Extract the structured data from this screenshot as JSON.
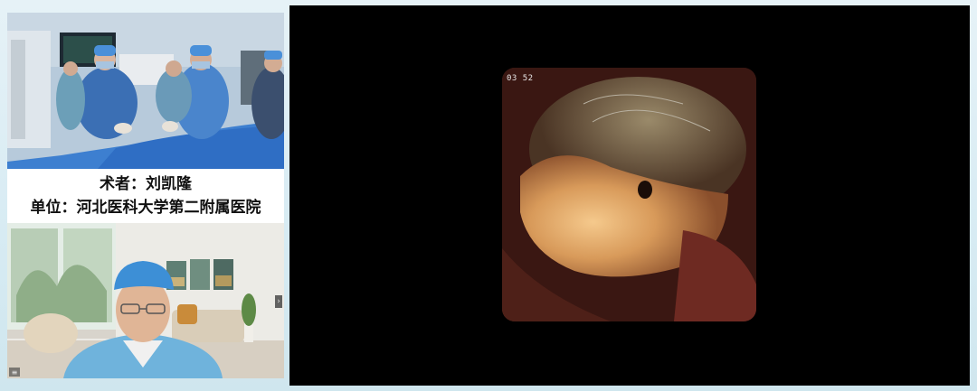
{
  "surgeon_caption": {
    "surgeon_line": "术者：刘凯隆",
    "unit_line": "单位：河北医科大学第二附属医院"
  },
  "endoscope_view": {
    "timestamp": "03 52"
  },
  "icons": {
    "side_arrow": "chevron-right-icon",
    "menu": "menu-icon"
  },
  "colors": {
    "background": "#dcedf4",
    "player_background": "#000000",
    "caption_background": "#ffffff"
  }
}
